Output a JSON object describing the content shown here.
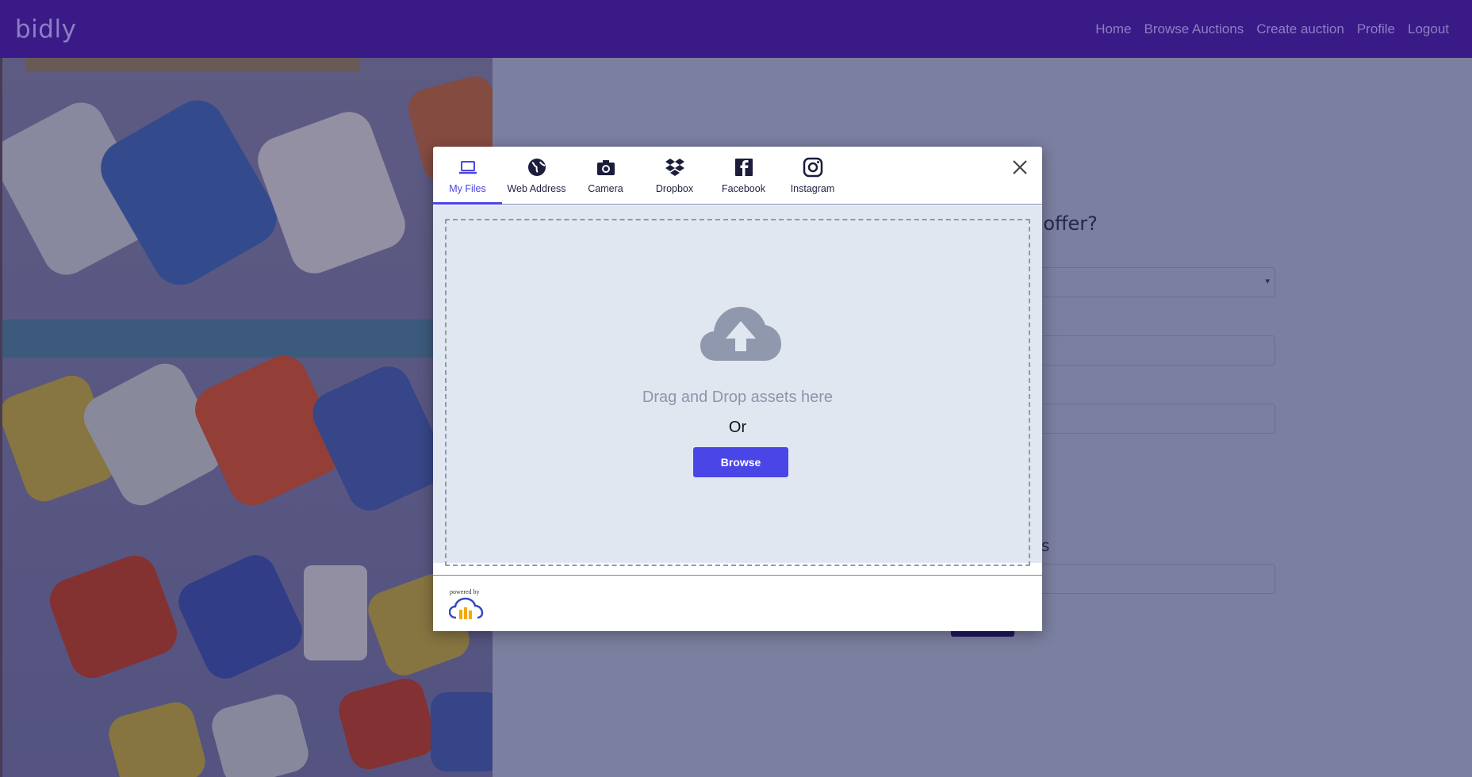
{
  "navbar": {
    "brand": "bidly",
    "links": [
      "Home",
      "Browse Auctions",
      "Create auction",
      "Profile",
      "Logout"
    ]
  },
  "background_form": {
    "question_fragment": "o offer?",
    "label_fragment": "s",
    "select_caret": "▾"
  },
  "upload_widget": {
    "tabs": [
      {
        "label": "My Files",
        "icon": "laptop-icon",
        "active": true
      },
      {
        "label": "Web Address",
        "icon": "globe-icon",
        "active": false
      },
      {
        "label": "Camera",
        "icon": "camera-icon",
        "active": false
      },
      {
        "label": "Dropbox",
        "icon": "dropbox-icon",
        "active": false
      },
      {
        "label": "Facebook",
        "icon": "facebook-icon",
        "active": false
      },
      {
        "label": "Instagram",
        "icon": "instagram-icon",
        "active": false
      }
    ],
    "drop_text": "Drag and Drop assets here",
    "or_text": "Or",
    "browse_label": "Browse",
    "powered_by": "powered by"
  },
  "colors": {
    "navbar": "#3a1a87",
    "accent": "#4a45e6",
    "overlay_bg": "#7b7fa0",
    "dropzone_bg": "#e1e7f0"
  }
}
